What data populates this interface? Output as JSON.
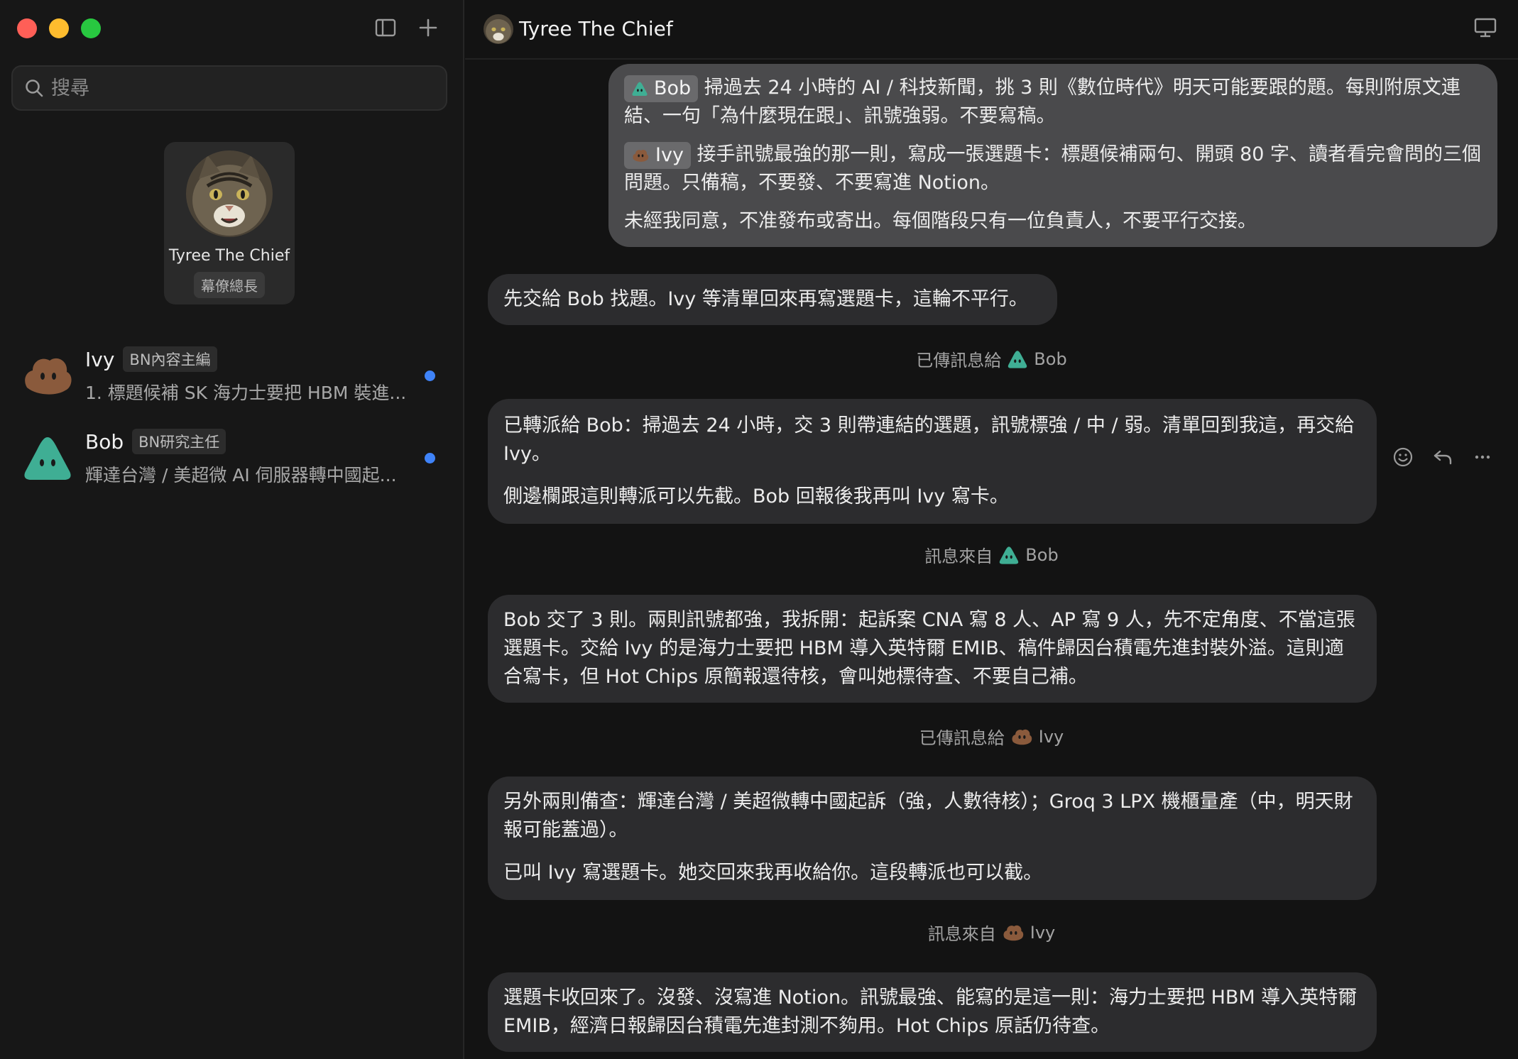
{
  "sidebar": {
    "search_placeholder": "搜尋",
    "featured_agent": {
      "name": "Tyree The Chief",
      "role": "幕僚總長"
    },
    "chats": [
      {
        "name": "Ivy",
        "tag": "BN內容主編",
        "preview": "1. 標題候補 SK 海力士要把 HBM 裝進...",
        "unread": true,
        "avatar": "brown-blob-icon"
      },
      {
        "name": "Bob",
        "tag": "BN研究主任",
        "preview": "輝達台灣 / 美超微 AI 伺服器轉中國起...",
        "unread": true,
        "avatar": "teal-triangle-icon"
      }
    ]
  },
  "header": {
    "title": "Tyree The Chief"
  },
  "messages": {
    "user": {
      "p1_mention": "Bob",
      "p1_text": "掃過去 24 小時的 AI / 科技新聞，挑 3 則《數位時代》明天可能要跟的題。每則附原文連結、一句「為什麼現在跟」、訊號強弱。不要寫稿。",
      "p2_mention": "Ivy",
      "p2_text": "接手訊號最強的那一則，寫成一張選題卡：標題候補兩句、開頭 80 字、讀者看完會問的三個問題。只備稿，不要發、不要寫進 Notion。",
      "p3_text": "未經我同意，不准發布或寄出。每個階段只有一位負責人，不要平行交接。"
    },
    "reply1": "先交給 Bob 找題。Ivy 等清單回來再寫選題卡，這輪不平行。",
    "sys1": {
      "label": "已傳訊息給",
      "who": "Bob"
    },
    "reply2": {
      "p1": "已轉派給 Bob：掃過去 24 小時，交 3 則帶連結的選題，訊號標強 / 中 / 弱。清單回到我這，再交給 Ivy。",
      "p2": "側邊欄跟這則轉派可以先截。Bob 回報後我再叫 Ivy 寫卡。"
    },
    "sys2": {
      "label": "訊息來自",
      "who": "Bob"
    },
    "reply3": "Bob 交了 3 則。兩則訊號都強，我拆開：起訴案 CNA 寫 8 人、AP 寫 9 人，先不定角度、不當這張選題卡。交給 Ivy 的是海力士要把 HBM 導入英特爾 EMIB、稿件歸因台積電先進封裝外溢。這則適合寫卡，但 Hot Chips 原簡報還待核，會叫她標待查、不要自己補。",
    "sys3": {
      "label": "已傳訊息給",
      "who": "Ivy"
    },
    "reply4": {
      "p1": "另外兩則備查：輝達台灣 / 美超微轉中國起訴（強，人數待核）；Groq 3 LPX 機櫃量產（中，明天財報可能蓋過）。",
      "p2": "已叫 Ivy 寫選題卡。她交回來我再收給你。這段轉派也可以截。"
    },
    "sys4": {
      "label": "訊息來自",
      "who": "Ivy"
    },
    "reply5": "選題卡收回來了。沒發、沒寫進 Notion。訊號最強、能寫的是這一則：海力士要把 HBM 導入英特爾 EMIB，經濟日報歸因台積電先進封測不夠用。Hot Chips 原話仍待查。"
  },
  "colors": {
    "accent_unread": "#3f83f8",
    "bob": "#3fae94",
    "ivy": "#8a5a3c"
  }
}
